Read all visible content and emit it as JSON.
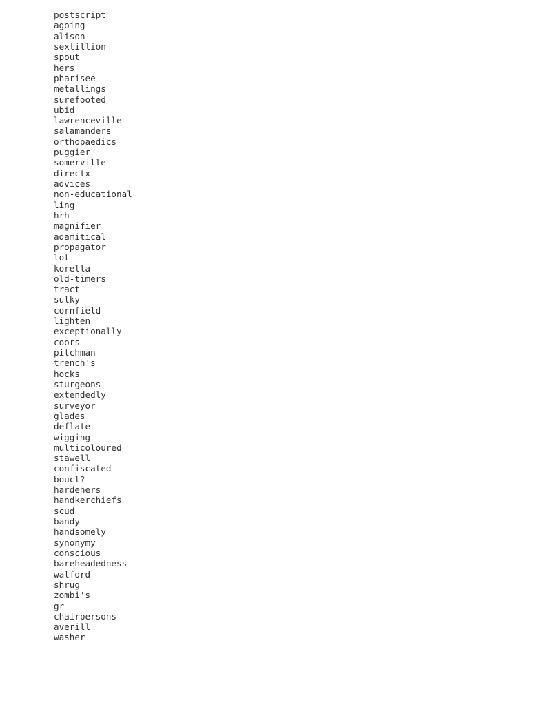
{
  "document": {
    "type": "plain-text-word-list",
    "background_color": "#ffffff",
    "text_color": "#333333",
    "line_count": 60,
    "words": [
      "postscript",
      "agoing",
      "alison",
      "sextillion",
      "spout",
      "hers",
      "pharisee",
      "metallings",
      "surefooted",
      "ubid",
      "lawrenceville",
      "salamanders",
      "orthopaedics",
      "puggier",
      "somerville",
      "directx",
      "advices",
      "non-educational",
      "ling",
      "hrh",
      "magnifier",
      "adamitical",
      "propagator",
      "lot",
      "korella",
      "old-timers",
      "tract",
      "sulky",
      "cornfield",
      "lighten",
      "exceptionally",
      "coors",
      "pitchman",
      "trench's",
      "hocks",
      "sturgeons",
      "extendedly",
      "surveyor",
      "glades",
      "deflate",
      "wigging",
      "multicoloured",
      "stawell",
      "confiscated",
      "boucl?",
      "hardeners",
      "handkerchiefs",
      "scud",
      "bandy",
      "handsomely",
      "synonymy",
      "conscious",
      "bareheadedness",
      "walford",
      "shrug",
      "zombi's",
      "gr",
      "chairpersons",
      "averill",
      "washer"
    ]
  }
}
